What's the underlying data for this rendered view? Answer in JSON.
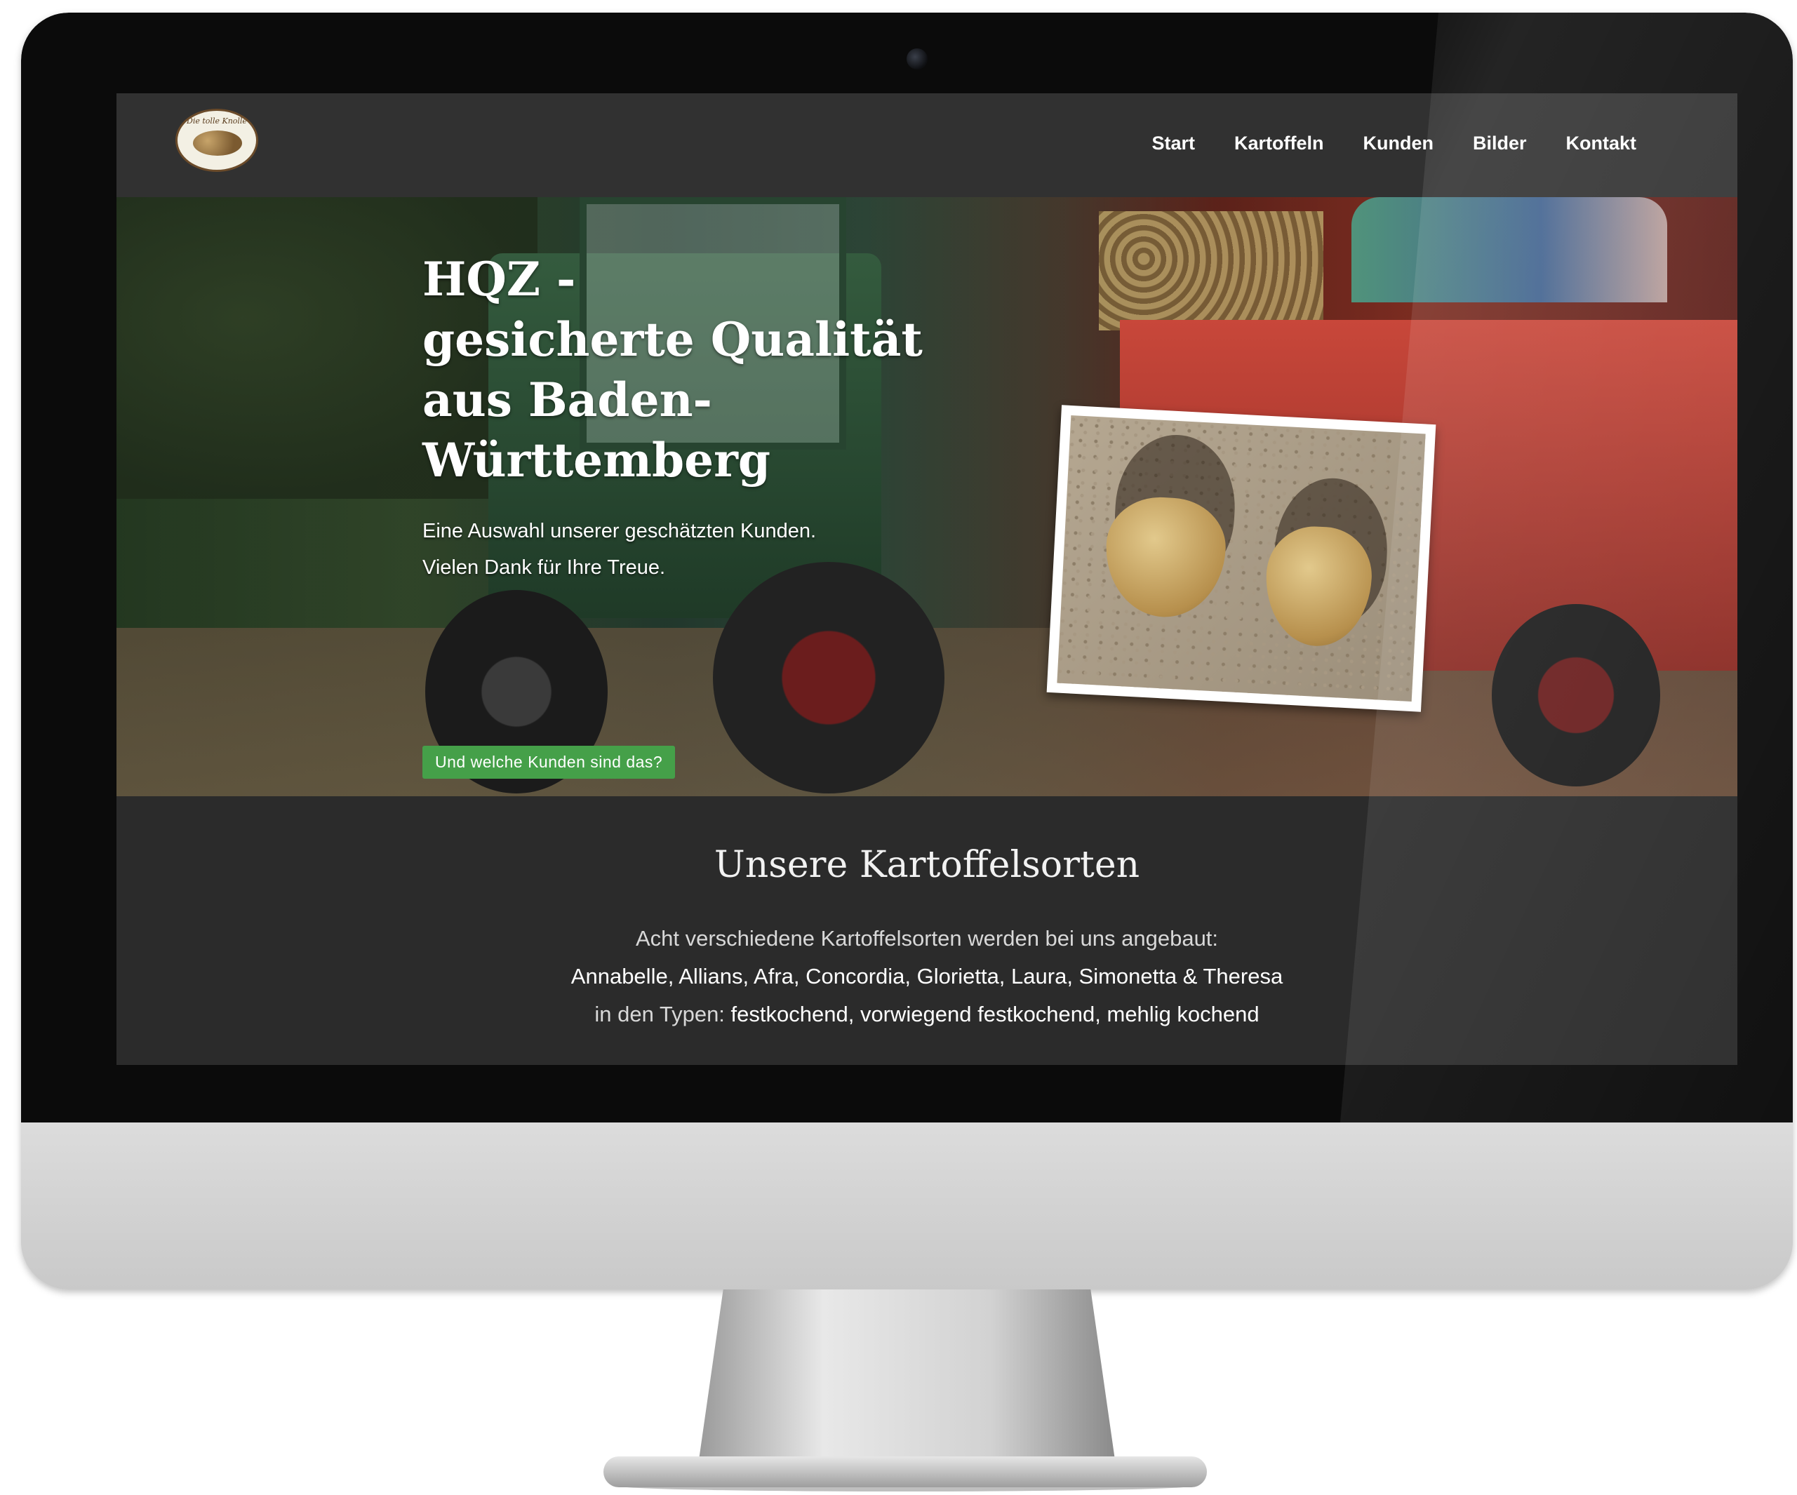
{
  "header": {
    "logo_alt": "Die tolle Knolle"
  },
  "nav": {
    "items": [
      "Start",
      "Kartoffeln",
      "Kunden",
      "Bilder",
      "Kontakt"
    ]
  },
  "hero": {
    "title_lines": [
      "HQZ -",
      "gesicherte Qualität",
      "aus Baden-",
      "Württemberg"
    ],
    "subtitle_lines": [
      "Eine Auswahl unserer geschätzten Kunden.",
      "Vielen Dank für Ihre Treue."
    ],
    "button_label": "Und welche Kunden sind das?"
  },
  "section": {
    "title": "Unsere Kartoffelsorten",
    "line1": "Acht verschiedene Kartoffelsorten werden bei uns angebaut:",
    "line2": "Annabelle, Allians, Afra, Concordia, Glorietta, Laura, Simonetta & Theresa",
    "line3_prefix": "in den Typen: ",
    "line3_types": "festkochend, vorwiegend festkochend, mehlig kochend"
  },
  "colors": {
    "accent_button": "#45a049",
    "header_bg": "#313131",
    "section_bg": "#2b2b2b"
  }
}
